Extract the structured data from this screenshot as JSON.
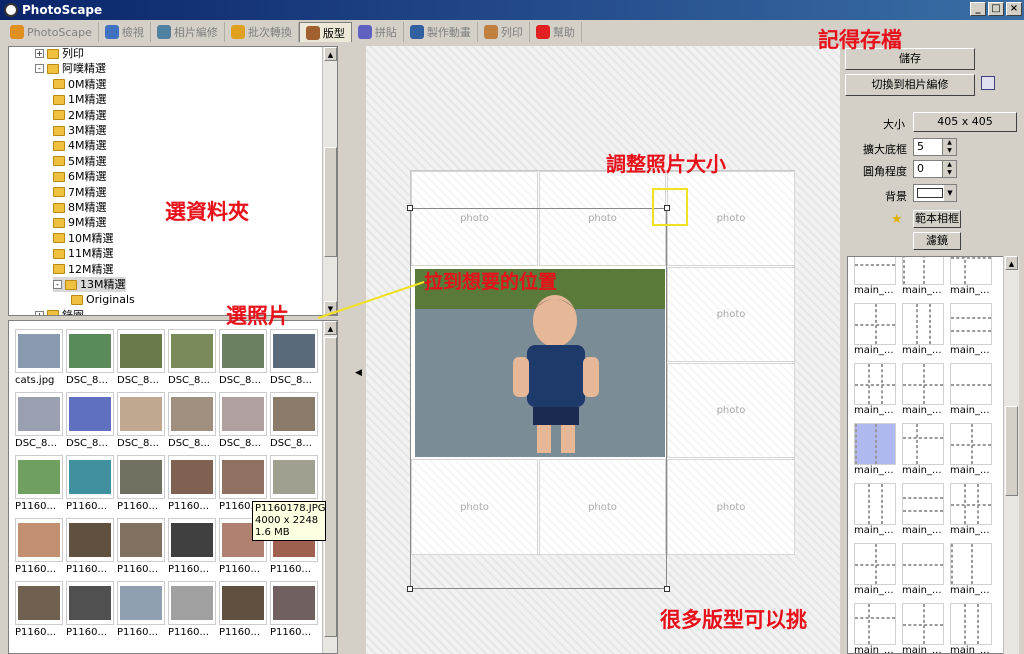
{
  "window": {
    "title": "PhotoScape"
  },
  "tabs": [
    {
      "label": "PhotoScape",
      "color": "#e09020"
    },
    {
      "label": "檢視",
      "color": "#4070c0"
    },
    {
      "label": "相片編修",
      "color": "#5080a0"
    },
    {
      "label": "批次轉換",
      "color": "#e0a020"
    },
    {
      "label": "版型",
      "color": "#a06030"
    },
    {
      "label": "拼貼",
      "color": "#6060c0"
    },
    {
      "label": "製作動畫",
      "color": "#3060a0"
    },
    {
      "label": "列印",
      "color": "#c08040"
    },
    {
      "label": "幫助",
      "color": "#e02020"
    }
  ],
  "tree": {
    "items": [
      {
        "label": "列印",
        "exp": "+"
      },
      {
        "label": "阿噗精選",
        "exp": "-"
      },
      {
        "label": "0M精選"
      },
      {
        "label": "1M精選"
      },
      {
        "label": "2M精選"
      },
      {
        "label": "3M精選"
      },
      {
        "label": "4M精選"
      },
      {
        "label": "5M精選"
      },
      {
        "label": "6M精選"
      },
      {
        "label": "7M精選"
      },
      {
        "label": "8M精選"
      },
      {
        "label": "9M精選"
      },
      {
        "label": "10M精選"
      },
      {
        "label": "11M精選"
      },
      {
        "label": "12M精選"
      },
      {
        "label": "13M精選",
        "exp": "-",
        "selected": true
      },
      {
        "label": "Originals"
      },
      {
        "label": "錄園",
        "exp": "+"
      }
    ]
  },
  "thumbs": [
    {
      "label": "cats.jpg",
      "c": "#8a9ab0"
    },
    {
      "label": "DSC_8...",
      "c": "#5a8a5a"
    },
    {
      "label": "DSC_8...",
      "c": "#6a7a4a"
    },
    {
      "label": "DSC_8...",
      "c": "#7a8a5a"
    },
    {
      "label": "DSC_8...",
      "c": "#6a8060"
    },
    {
      "label": "DSC_8...",
      "c": "#5a6a7a"
    },
    {
      "label": "DSC_8...",
      "c": "#9aa0b0"
    },
    {
      "label": "DSC_8...",
      "c": "#6070c0"
    },
    {
      "label": "DSC_8...",
      "c": "#c0a890"
    },
    {
      "label": "DSC_8...",
      "c": "#a09080"
    },
    {
      "label": "DSC_8...",
      "c": "#b0a0a0"
    },
    {
      "label": "DSC_8...",
      "c": "#8a7a6a"
    },
    {
      "label": "P1160...",
      "c": "#70a060"
    },
    {
      "label": "P1160...",
      "c": "#4090a0"
    },
    {
      "label": "P1160...",
      "c": "#707060"
    },
    {
      "label": "P1160...",
      "c": "#806050"
    },
    {
      "label": "P1160...",
      "c": "#907060"
    },
    {
      "label": "P1160...",
      "c": "#a0a090"
    },
    {
      "label": "P1160...",
      "c": "#c09070"
    },
    {
      "label": "P1160...",
      "c": "#605040"
    },
    {
      "label": "P1160...",
      "c": "#807060"
    },
    {
      "label": "P1160...",
      "c": "#404040"
    },
    {
      "label": "P1160...",
      "c": "#b08070"
    },
    {
      "label": "P1160...",
      "c": "#a06050"
    },
    {
      "label": "P1160...",
      "c": "#706050"
    },
    {
      "label": "P1160...",
      "c": "#505050"
    },
    {
      "label": "P1160...",
      "c": "#90a0b0"
    },
    {
      "label": "P1160...",
      "c": "#a0a0a0"
    },
    {
      "label": "P1160...",
      "c": "#605040"
    },
    {
      "label": "P1160...",
      "c": "#706060"
    }
  ],
  "tooltip": {
    "name": "P1160178.JPG",
    "dims": "4000 x 2248",
    "size": "1.6 MB"
  },
  "canvas": {
    "placeholder": "photo"
  },
  "right": {
    "save": "儲存",
    "switch": "切換到相片編修",
    "size_label": "大小",
    "size_value": "405 x 405",
    "expand_label": "擴大底框",
    "expand_value": "5",
    "round_label": "圓角程度",
    "round_value": "0",
    "bg_label": "背景",
    "sample_frame": "範本相框",
    "filter": "濾鏡"
  },
  "layouts": {
    "name": "main_...",
    "count": 21,
    "highlight": 9
  },
  "annotations": {
    "save_file": "記得存檔",
    "resize": "調整照片大小",
    "select_folder": "選資料夾",
    "drag": "拉到想要的位置",
    "select_photo": "選照片",
    "many_layouts": "很多版型可以挑"
  }
}
